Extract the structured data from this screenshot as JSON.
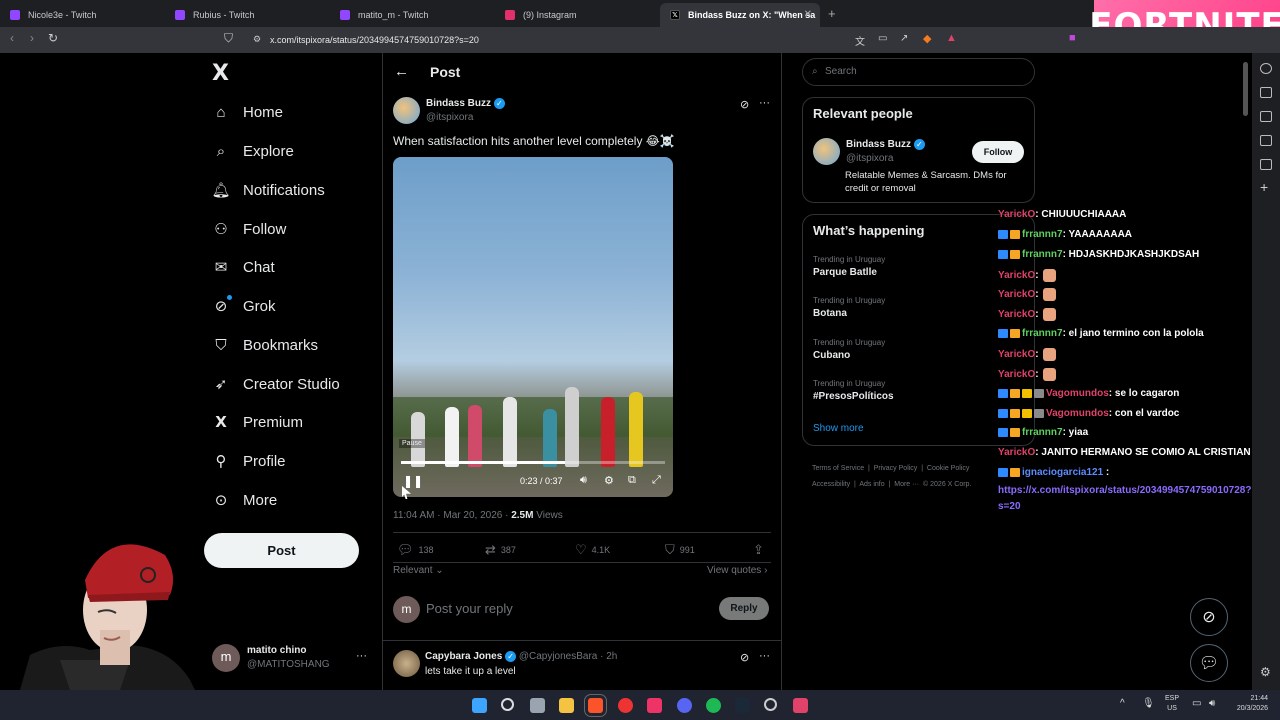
{
  "browser": {
    "tabs": [
      {
        "label": "Nicole3e - Twitch",
        "color": "#9146ff"
      },
      {
        "label": "Rubius - Twitch",
        "color": "#9146ff"
      },
      {
        "label": "matito_m - Twitch",
        "color": "#9146ff"
      },
      {
        "label": "(9) Instagram",
        "color": "#e1306c"
      },
      {
        "label": "Bindass Buzz on X: \"When sa",
        "color": "#000000"
      }
    ],
    "url": "x.com/itspixora/status/2034994574759010728?s=20"
  },
  "overlay": {
    "game_logo": "FORTNITE"
  },
  "sidebar": {
    "logo": "X",
    "items": [
      {
        "label": "Home",
        "icon": "home-icon"
      },
      {
        "label": "Explore",
        "icon": "search-icon"
      },
      {
        "label": "Notifications",
        "icon": "bell-icon"
      },
      {
        "label": "Follow",
        "icon": "person-add-icon"
      },
      {
        "label": "Chat",
        "icon": "mail-icon"
      },
      {
        "label": "Grok",
        "icon": "grok-icon"
      },
      {
        "label": "Bookmarks",
        "icon": "bookmark-icon"
      },
      {
        "label": "Creator Studio",
        "icon": "rocket-icon"
      },
      {
        "label": "Premium",
        "icon": "x-icon"
      },
      {
        "label": "Profile",
        "icon": "person-icon"
      },
      {
        "label": "More",
        "icon": "more-icon"
      }
    ],
    "post_button": "Post",
    "account": {
      "name": "matito chino",
      "handle": "@MATITOSHANG",
      "avatar_letter": "m"
    }
  },
  "main": {
    "header_title": "Post",
    "tweet": {
      "author": "Bindass Buzz",
      "handle": "@itspixora",
      "text": "When satisfaction hits another level completely 😂☠️",
      "video": {
        "tooltip": "Pause",
        "time": "0:23 / 0:37",
        "progress": 0.62
      },
      "timestamp": "11:04 AM · Mar 20, 2026 · ",
      "views_count": "2.5M",
      "views_label": " Views",
      "stats": {
        "replies": "138",
        "reposts": "387",
        "likes": "4.1K",
        "bookmarks": "991"
      },
      "sort": "Relevant",
      "view_quotes": "View quotes"
    },
    "reply_box": {
      "avatar_letter": "m",
      "placeholder": "Post your reply",
      "button": "Reply"
    },
    "reply": {
      "author": "Capybara Jones",
      "handle": "@CapyjonesBara · 2h",
      "text": "lets take it up a level"
    }
  },
  "right": {
    "search_placeholder": "Search",
    "relevant": {
      "title": "Relevant people",
      "name": "Bindass Buzz",
      "handle": "@itspixora",
      "bio": "Relatable Memes & Sarcasm. DMs for credit or removal",
      "follow": "Follow"
    },
    "happening": {
      "title": "What’s happening",
      "trends": [
        {
          "context": "Trending in Uruguay",
          "topic": "Parque Batlle"
        },
        {
          "context": "Trending in Uruguay",
          "topic": "Botana"
        },
        {
          "context": "Trending in Uruguay",
          "topic": "Cubano"
        },
        {
          "context": "Trending in Uruguay",
          "topic": "#PresosPolíticos"
        }
      ],
      "show_more": "Show more"
    },
    "footer": {
      "links": [
        "Terms of Service",
        "Privacy Policy",
        "Cookie Policy",
        "Accessibility",
        "Ads info",
        "More ···",
        "© 2026 X Corp."
      ]
    }
  },
  "chat": [
    {
      "user": "YarickO",
      "color": "#e0426a",
      "msg": ": CHIUUUCHIAAAA",
      "badges": 0,
      "emote": false
    },
    {
      "user": "frrannn7",
      "color": "#5fd15f",
      "msg": ": YAAAAAAAA",
      "badges": 2,
      "emote": false
    },
    {
      "user": "frrannn7",
      "color": "#5fd15f",
      "msg": ": HDJASKHDJKASHJKDSAH",
      "badges": 2,
      "emote": false
    },
    {
      "user": "YarickO",
      "color": "#e0426a",
      "msg": ":",
      "badges": 0,
      "emote": true
    },
    {
      "user": "YarickO",
      "color": "#e0426a",
      "msg": ":",
      "badges": 0,
      "emote": true
    },
    {
      "user": "YarickO",
      "color": "#e0426a",
      "msg": ":",
      "badges": 0,
      "emote": true
    },
    {
      "user": "frrannn7",
      "color": "#5fd15f",
      "msg": ": el jano termino con la polola",
      "badges": 2,
      "emote": false
    },
    {
      "user": "YarickO",
      "color": "#e0426a",
      "msg": ":",
      "badges": 0,
      "emote": true
    },
    {
      "user": "YarickO",
      "color": "#e0426a",
      "msg": ":",
      "badges": 0,
      "emote": true
    },
    {
      "user": "Vagomundos",
      "color": "#e0426a",
      "msg": ": se lo cagaron",
      "badges": 4,
      "emote": false
    },
    {
      "user": "Vagomundos",
      "color": "#e0426a",
      "msg": ": con el vardoc",
      "badges": 4,
      "emote": false
    },
    {
      "user": "frrannn7",
      "color": "#5fd15f",
      "msg": ": yiaa",
      "badges": 2,
      "emote": false
    },
    {
      "user": "YarickO",
      "color": "#e0426a",
      "msg": ": JANITO HERMANO SE COMIO AL CRISTIAN",
      "badges": 0,
      "emote": false
    },
    {
      "user": "ignaciogarcia121",
      "color": "#5b8cff",
      "msg": " :",
      "badges": 2,
      "emote": false
    }
  ],
  "chat_link": {
    "line1": "https://x.com/itspixora/status/2034994574759010728?",
    "line2": "s=20"
  },
  "taskbar": {
    "lang": "ESP",
    "region": "US",
    "time": "21:44",
    "date": "20/3/2026"
  }
}
